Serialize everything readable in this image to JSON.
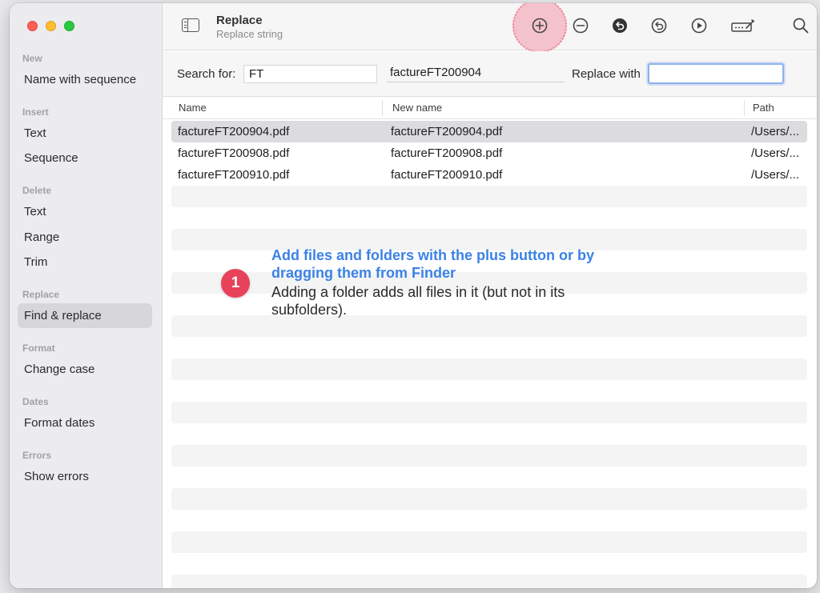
{
  "window": {
    "title": "Replace",
    "subtitle": "Replace string"
  },
  "colors": {
    "accent": "#3b82e6",
    "badge": "#e8425a",
    "highlight": "#f4a0b2"
  },
  "sidebar": {
    "sections": [
      {
        "title": "New",
        "items": [
          "Name with sequence"
        ]
      },
      {
        "title": "Insert",
        "items": [
          "Text",
          "Sequence"
        ]
      },
      {
        "title": "Delete",
        "items": [
          "Text",
          "Range",
          "Trim"
        ]
      },
      {
        "title": "Replace",
        "items": [
          "Find & replace"
        ]
      },
      {
        "title": "Format",
        "items": [
          "Change case"
        ]
      },
      {
        "title": "Dates",
        "items": [
          "Format dates"
        ]
      },
      {
        "title": "Errors",
        "items": [
          "Show errors"
        ]
      }
    ],
    "active_item": "Find & replace"
  },
  "toolbar": {
    "icons": [
      "plus-circle-icon",
      "minus-circle-icon",
      "undo-filled-icon",
      "undo-icon",
      "play-icon",
      "rename-icon",
      "search-icon"
    ]
  },
  "search": {
    "label": "Search for:",
    "value": "FT",
    "preview": "factureFT200904",
    "replace_label": "Replace with",
    "replace_value": ""
  },
  "table": {
    "columns": [
      "Name",
      "New name",
      "Path"
    ],
    "rows": [
      {
        "name": "factureFT200904.pdf",
        "new_name": "factureFT200904.pdf",
        "path": "/Users/..."
      },
      {
        "name": "factureFT200908.pdf",
        "new_name": "factureFT200908.pdf",
        "path": "/Users/..."
      },
      {
        "name": "factureFT200910.pdf",
        "new_name": "factureFT200910.pdf",
        "path": "/Users/..."
      }
    ],
    "selected_row": 0
  },
  "help": {
    "badge": "1",
    "title": "Add files and folders with the plus button or by dragging them from Finder",
    "body": "Adding a folder adds all files in it (but not in its subfolders)."
  }
}
